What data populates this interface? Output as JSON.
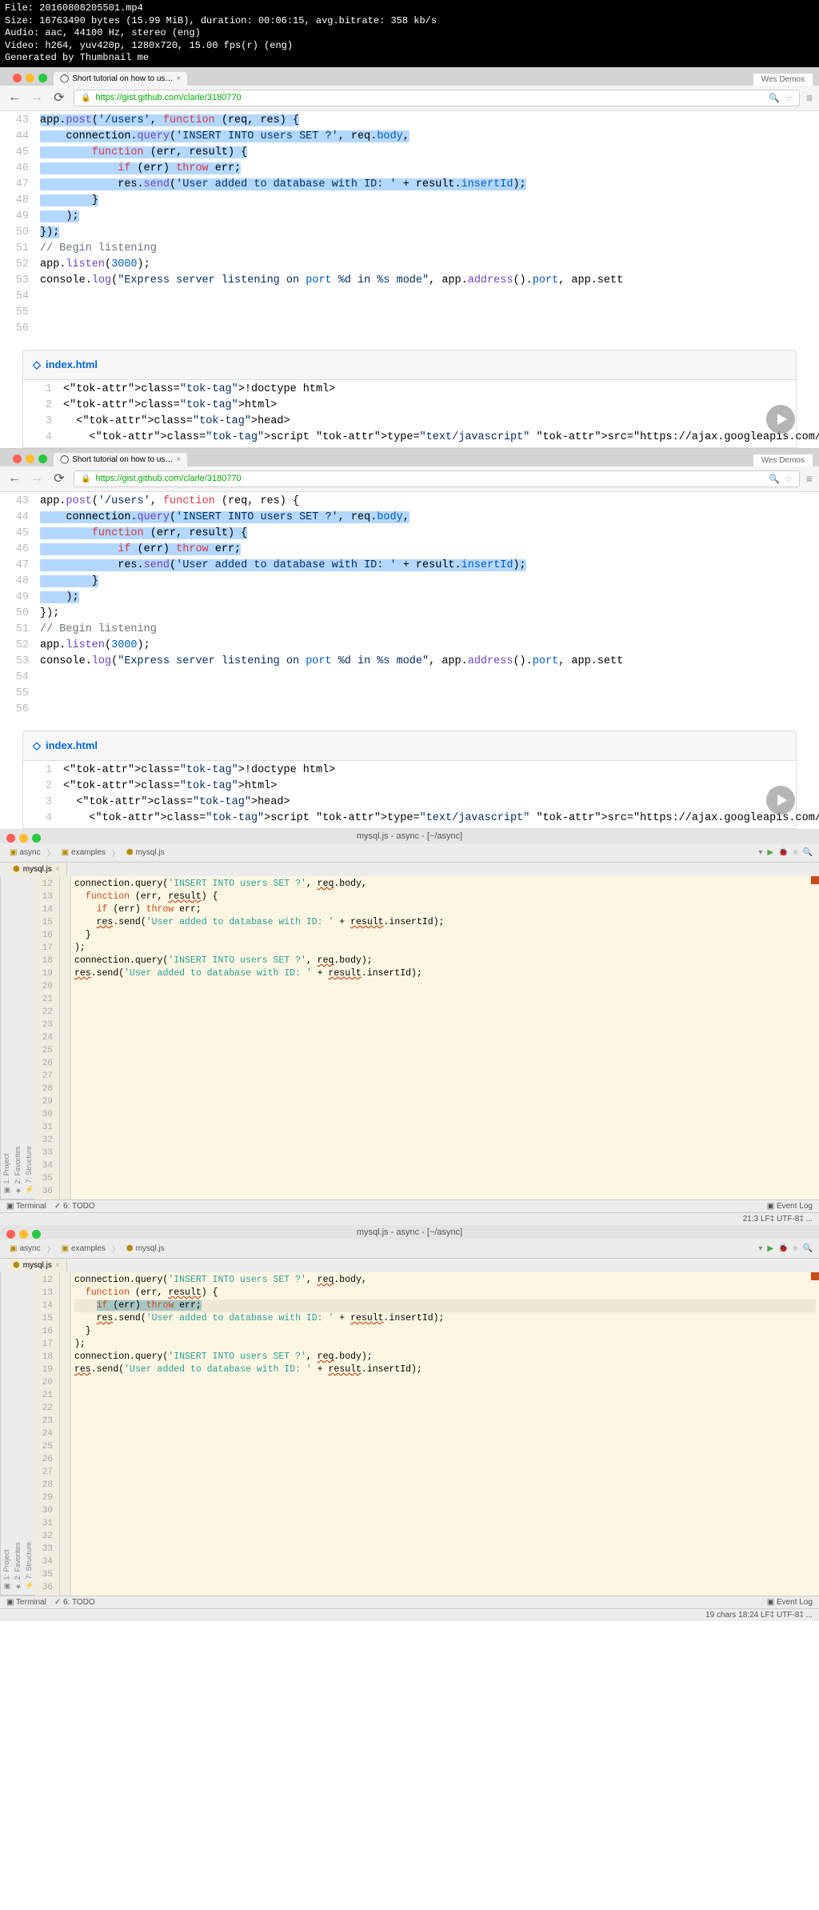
{
  "header": {
    "line1": "File: 20160808205501.mp4",
    "line2": "Size: 16763490 bytes (15.99 MiB), duration: 00:06:15, avg.bitrate: 358 kb/s",
    "line3": "Audio: aac, 44100 Hz, stereo (eng)",
    "line4": "Video: h264, yuv420p, 1280x720, 15.00 fps(r) (eng)",
    "line5": "Generated by Thumbnail me"
  },
  "browser": {
    "tab_title": "Short tutorial on how to us…",
    "demos": "Wes Demos",
    "url": "https://gist.github.com/clarle/3180770",
    "file2_name": "index.html"
  },
  "code1": [
    {
      "n": "43",
      "t": ""
    },
    {
      "n": "44",
      "t": "app.post('/users', function (req, res) {"
    },
    {
      "n": "45",
      "t": "    connection.query('INSERT INTO users SET ?', req.body,"
    },
    {
      "n": "46",
      "t": "        function (err, result) {"
    },
    {
      "n": "47",
      "t": "            if (err) throw err;"
    },
    {
      "n": "48",
      "t": "            res.send('User added to database with ID: ' + result.insertId);"
    },
    {
      "n": "49",
      "t": "        }"
    },
    {
      "n": "50",
      "t": "    );"
    },
    {
      "n": "51",
      "t": "});"
    },
    {
      "n": "52",
      "t": ""
    },
    {
      "n": "53",
      "t": "// Begin listening"
    },
    {
      "n": "54",
      "t": ""
    },
    {
      "n": "55",
      "t": "app.listen(3000);"
    },
    {
      "n": "56",
      "t": "console.log(\"Express server listening on port %d in %s mode\", app.address().port, app.sett"
    }
  ],
  "code2": [
    {
      "n": "1",
      "t": "<!doctype html>"
    },
    {
      "n": "2",
      "t": "<html>"
    },
    {
      "n": "3",
      "t": "  <head>"
    },
    {
      "n": "4",
      "t": "    <script type=\"text/javascript\" src=\"https://ajax.googleapis.com/ajax/libs/jquery/..."
    }
  ],
  "ide": {
    "title": "mysql.js - async - [~/async]",
    "crumbs": [
      "async",
      "examples",
      "mysql.js"
    ],
    "tab": "mysql.js",
    "terminal": "Terminal",
    "todo": "6: TODO",
    "eventlog": "Event Log",
    "status1": "21:3   LF‡   UTF-8‡  ...",
    "status2": "19 chars    18:24   LF‡   UTF-8‡  ..."
  },
  "ide_code1": [
    {
      "n": "12",
      "t": ""
    },
    {
      "n": "13",
      "t": ""
    },
    {
      "n": "14",
      "t": ""
    },
    {
      "n": "15",
      "t": ""
    },
    {
      "n": "16",
      "t": "connection.query('INSERT INTO users SET ?', req.body,"
    },
    {
      "n": "17",
      "t": "  function (err, result) {"
    },
    {
      "n": "18",
      "t": "    if (err) throw err;"
    },
    {
      "n": "19",
      "t": "    res.send('User added to database with ID: ' + result.insertId);"
    },
    {
      "n": "20",
      "t": "  }"
    },
    {
      "n": "21",
      "t": ");"
    },
    {
      "n": "22",
      "t": ""
    },
    {
      "n": "23",
      "t": "connection.query('INSERT INTO users SET ?', req.body);"
    },
    {
      "n": "24",
      "t": "res.send('User added to database with ID: ' + result.insertId);"
    },
    {
      "n": "25",
      "t": ""
    },
    {
      "n": "26",
      "t": ""
    },
    {
      "n": "27",
      "t": ""
    },
    {
      "n": "28",
      "t": ""
    },
    {
      "n": "29",
      "t": ""
    },
    {
      "n": "30",
      "t": ""
    },
    {
      "n": "31",
      "t": ""
    },
    {
      "n": "32",
      "t": ""
    },
    {
      "n": "33",
      "t": ""
    },
    {
      "n": "34",
      "t": ""
    },
    {
      "n": "35",
      "t": ""
    },
    {
      "n": "36",
      "t": ""
    }
  ],
  "ide_code2": [
    {
      "n": "12",
      "t": ""
    },
    {
      "n": "13",
      "t": ""
    },
    {
      "n": "14",
      "t": ""
    },
    {
      "n": "15",
      "t": ""
    },
    {
      "n": "16",
      "t": "connection.query('INSERT INTO users SET ?', req.body,"
    },
    {
      "n": "17",
      "t": "  function (err, result) {"
    },
    {
      "n": "18",
      "t": "    if (err) throw err;"
    },
    {
      "n": "19",
      "t": "    res.send('User added to database with ID: ' + result.insertId);"
    },
    {
      "n": "20",
      "t": "  }"
    },
    {
      "n": "21",
      "t": ");"
    },
    {
      "n": "22",
      "t": ""
    },
    {
      "n": "23",
      "t": "connection.query('INSERT INTO users SET ?', req.body);"
    },
    {
      "n": "24",
      "t": "res.send('User added to database with ID: ' + result.insertId);"
    },
    {
      "n": "25",
      "t": ""
    },
    {
      "n": "26",
      "t": ""
    },
    {
      "n": "27",
      "t": ""
    },
    {
      "n": "28",
      "t": ""
    },
    {
      "n": "29",
      "t": ""
    },
    {
      "n": "30",
      "t": ""
    },
    {
      "n": "31",
      "t": ""
    },
    {
      "n": "32",
      "t": ""
    },
    {
      "n": "33",
      "t": ""
    },
    {
      "n": "34",
      "t": ""
    },
    {
      "n": "35",
      "t": ""
    },
    {
      "n": "36",
      "t": ""
    }
  ]
}
